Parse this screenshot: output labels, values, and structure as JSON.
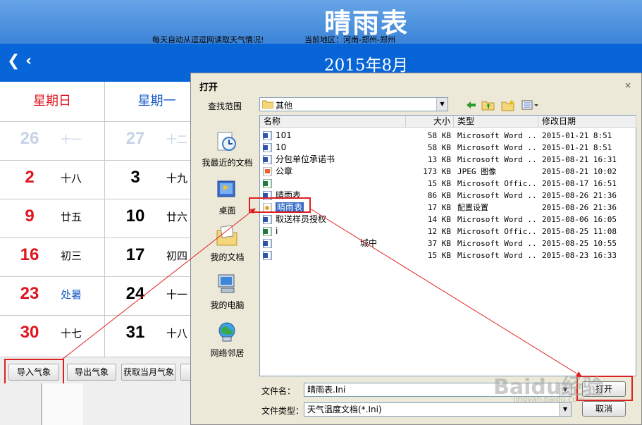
{
  "app": {
    "title": "晴雨表",
    "subtitle": "每天自动从逗逗网读取天气情况!",
    "region": "当前地区：河南-郑州-郑州",
    "nav_prev": "❮ ‹",
    "month": "2015年8月",
    "weekday_headers": [
      "星期日",
      "星期一"
    ],
    "rows": [
      {
        "sun": "26",
        "sun_lunar": "十一",
        "mon": "27",
        "mon_lunar": "十二"
      },
      {
        "sun": "2",
        "sun_lunar": "十八",
        "mon": "3",
        "mon_lunar": "十九"
      },
      {
        "sun": "9",
        "sun_lunar": "廿五",
        "mon": "10",
        "mon_lunar": "廿六"
      },
      {
        "sun": "16",
        "sun_lunar": "初三",
        "mon": "17",
        "mon_lunar": "初四"
      },
      {
        "sun": "23",
        "sun_lunar": "处暑",
        "mon": "24",
        "mon_lunar": "十一"
      },
      {
        "sun": "30",
        "sun_lunar": "十七",
        "mon": "31",
        "mon_lunar": "十八"
      }
    ],
    "buttons": {
      "import": "导入气象",
      "export": "导出气象",
      "fetch": "获取当月气象"
    }
  },
  "dialog": {
    "title": "打开",
    "close": "×",
    "lookin_label": "查找范围",
    "lookin_value": "其他",
    "places": [
      "我最近的文档",
      "桌面",
      "我的文档",
      "我的电脑",
      "网络邻居"
    ],
    "columns": {
      "name": "名称",
      "size": "大小",
      "type": "类型",
      "date": "修改日期"
    },
    "files": [
      {
        "name": "101",
        "size": "58 KB",
        "type": "Microsoft Word ...",
        "date": "2015-01-21 8:51",
        "icon": "word"
      },
      {
        "name": "10",
        "size": "58 KB",
        "type": "Microsoft Word ...",
        "date": "2015-01-21 8:51",
        "icon": "word"
      },
      {
        "name": "分包单位承诺书",
        "size": "13 KB",
        "type": "Microsoft Word ...",
        "date": "2015-08-21 16:31",
        "icon": "word"
      },
      {
        "name": "公章",
        "size": "173 KB",
        "type": "JPEG 图像",
        "date": "2015-08-21 10:02",
        "icon": "image"
      },
      {
        "name": "",
        "size": "15 KB",
        "type": "Microsoft Offic...",
        "date": "2015-08-17 16:51",
        "icon": "excel"
      },
      {
        "name": "晴雨表",
        "size": "86 KB",
        "type": "Microsoft Word ...",
        "date": "2015-08-26 21:36",
        "icon": "word"
      },
      {
        "name": "晴雨表",
        "size": "17 KB",
        "type": "配置设置",
        "date": "2015-08-26 21:36",
        "icon": "config",
        "selected": true
      },
      {
        "name": "取送样员授权",
        "size": "14 KB",
        "type": "Microsoft Word ...",
        "date": "2015-08-06 16:05",
        "icon": "word"
      },
      {
        "name": "i",
        "size": "12 KB",
        "type": "Microsoft Offic...",
        "date": "2015-08-25 11:08",
        "icon": "excel"
      },
      {
        "name": "城中",
        "size": "37 KB",
        "type": "Microsoft Word ...",
        "date": "2015-08-25 10:55",
        "icon": "word"
      },
      {
        "name": "",
        "size": "15 KB",
        "type": "Microsoft Word ...",
        "date": "2015-08-23 16:33",
        "icon": "word"
      }
    ],
    "filename_label": "文件名：",
    "filename_value": "晴雨表.Ini",
    "filetype_label": "文件类型：",
    "filetype_value": "天气温度文档(*.Ini)",
    "open_button": "打开",
    "cancel_button": "取消"
  },
  "watermark": {
    "text": "Baidu经验",
    "sub": "jingyan.baidu.com"
  },
  "colors": {
    "header": "#3c84d8",
    "month_bar": "#0865d8",
    "sunday": "#e0141e",
    "monday_header": "#1a5cc8",
    "annotation": "#e02020",
    "selection": "#316ac5"
  }
}
